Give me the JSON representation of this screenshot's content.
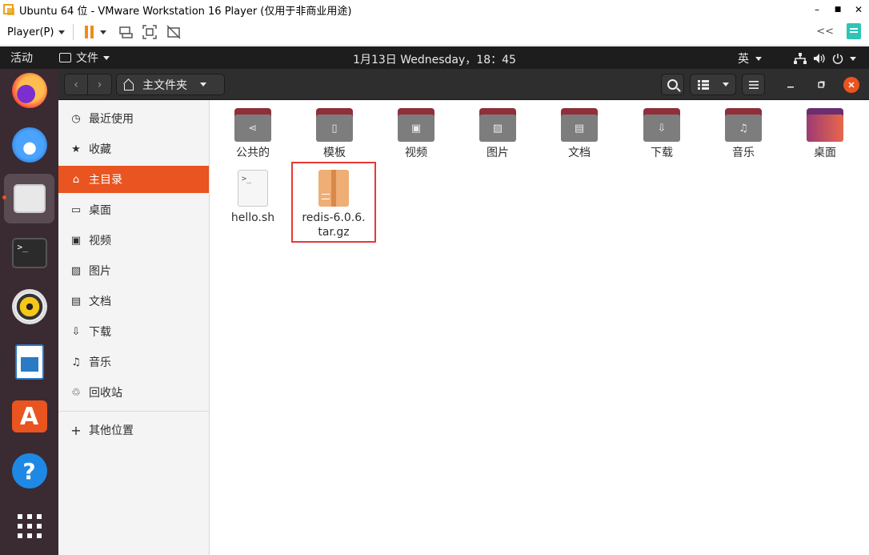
{
  "vm_window": {
    "title": "Ubuntu 64 位 - VMware Workstation 16 Player (仅用于非商业用途)",
    "controls": {
      "minimize": "–",
      "maximize": "■",
      "close": "✕"
    }
  },
  "vm_toolbar": {
    "player_menu": "Player(P)",
    "icons": [
      "pause-icon",
      "send-ctrl-alt-del-icon",
      "fit-guest-icon",
      "unity-icon"
    ],
    "right_arrows": "<<"
  },
  "gnome_top_bar": {
    "activities": "活动",
    "app_menu": "文件",
    "clock": "1月13日 Wednesday，18：45",
    "input_method": "英"
  },
  "dock": {
    "items": [
      "firefox",
      "thunderbird",
      "files",
      "terminal",
      "rhythmbox",
      "libreoffice-writer",
      "ubuntu-software",
      "help",
      "show-applications"
    ],
    "active_item": "files",
    "terminal_glyph": ">_",
    "store_glyph": "A",
    "help_glyph": "?"
  },
  "header_bar": {
    "back": "‹",
    "forward": "›",
    "location": "主文件夹"
  },
  "sidebar": {
    "items": [
      {
        "label": "最近使用",
        "icon": "clock-icon",
        "glyph": "◷"
      },
      {
        "label": "收藏",
        "icon": "star-icon",
        "glyph": "★"
      },
      {
        "label": "主目录",
        "icon": "home-icon",
        "glyph": "⌂"
      },
      {
        "label": "桌面",
        "icon": "desktop-icon",
        "glyph": "▭"
      },
      {
        "label": "视频",
        "icon": "video-icon",
        "glyph": "▣"
      },
      {
        "label": "图片",
        "icon": "image-icon",
        "glyph": "▨"
      },
      {
        "label": "文档",
        "icon": "document-icon",
        "glyph": "▤"
      },
      {
        "label": "下载",
        "icon": "download-icon",
        "glyph": "⇩"
      },
      {
        "label": "音乐",
        "icon": "music-icon",
        "glyph": "♫"
      },
      {
        "label": "回收站",
        "icon": "trash-icon",
        "glyph": "♲"
      }
    ],
    "selected_index": 2,
    "other_locations": {
      "label": "其他位置",
      "glyph": "+"
    }
  },
  "content": {
    "folders": [
      {
        "label": "公共的",
        "glyph": "⋖"
      },
      {
        "label": "模板",
        "glyph": "▯"
      },
      {
        "label": "视频",
        "glyph": "▣"
      },
      {
        "label": "图片",
        "glyph": "▨"
      },
      {
        "label": "文档",
        "glyph": "▤"
      },
      {
        "label": "下载",
        "glyph": "⇩"
      },
      {
        "label": "音乐",
        "glyph": "♫"
      },
      {
        "label": "桌面",
        "glyph": ""
      }
    ],
    "files": [
      {
        "label": "hello.sh",
        "glyph": ">_"
      },
      {
        "label": "redis-6.0.6.\ntar.gz"
      }
    ]
  },
  "colors": {
    "accent": "#e95420",
    "dock_bg": "#3a2a32",
    "header_bg": "#2e2e2e",
    "highlight_box": "#e53935"
  }
}
